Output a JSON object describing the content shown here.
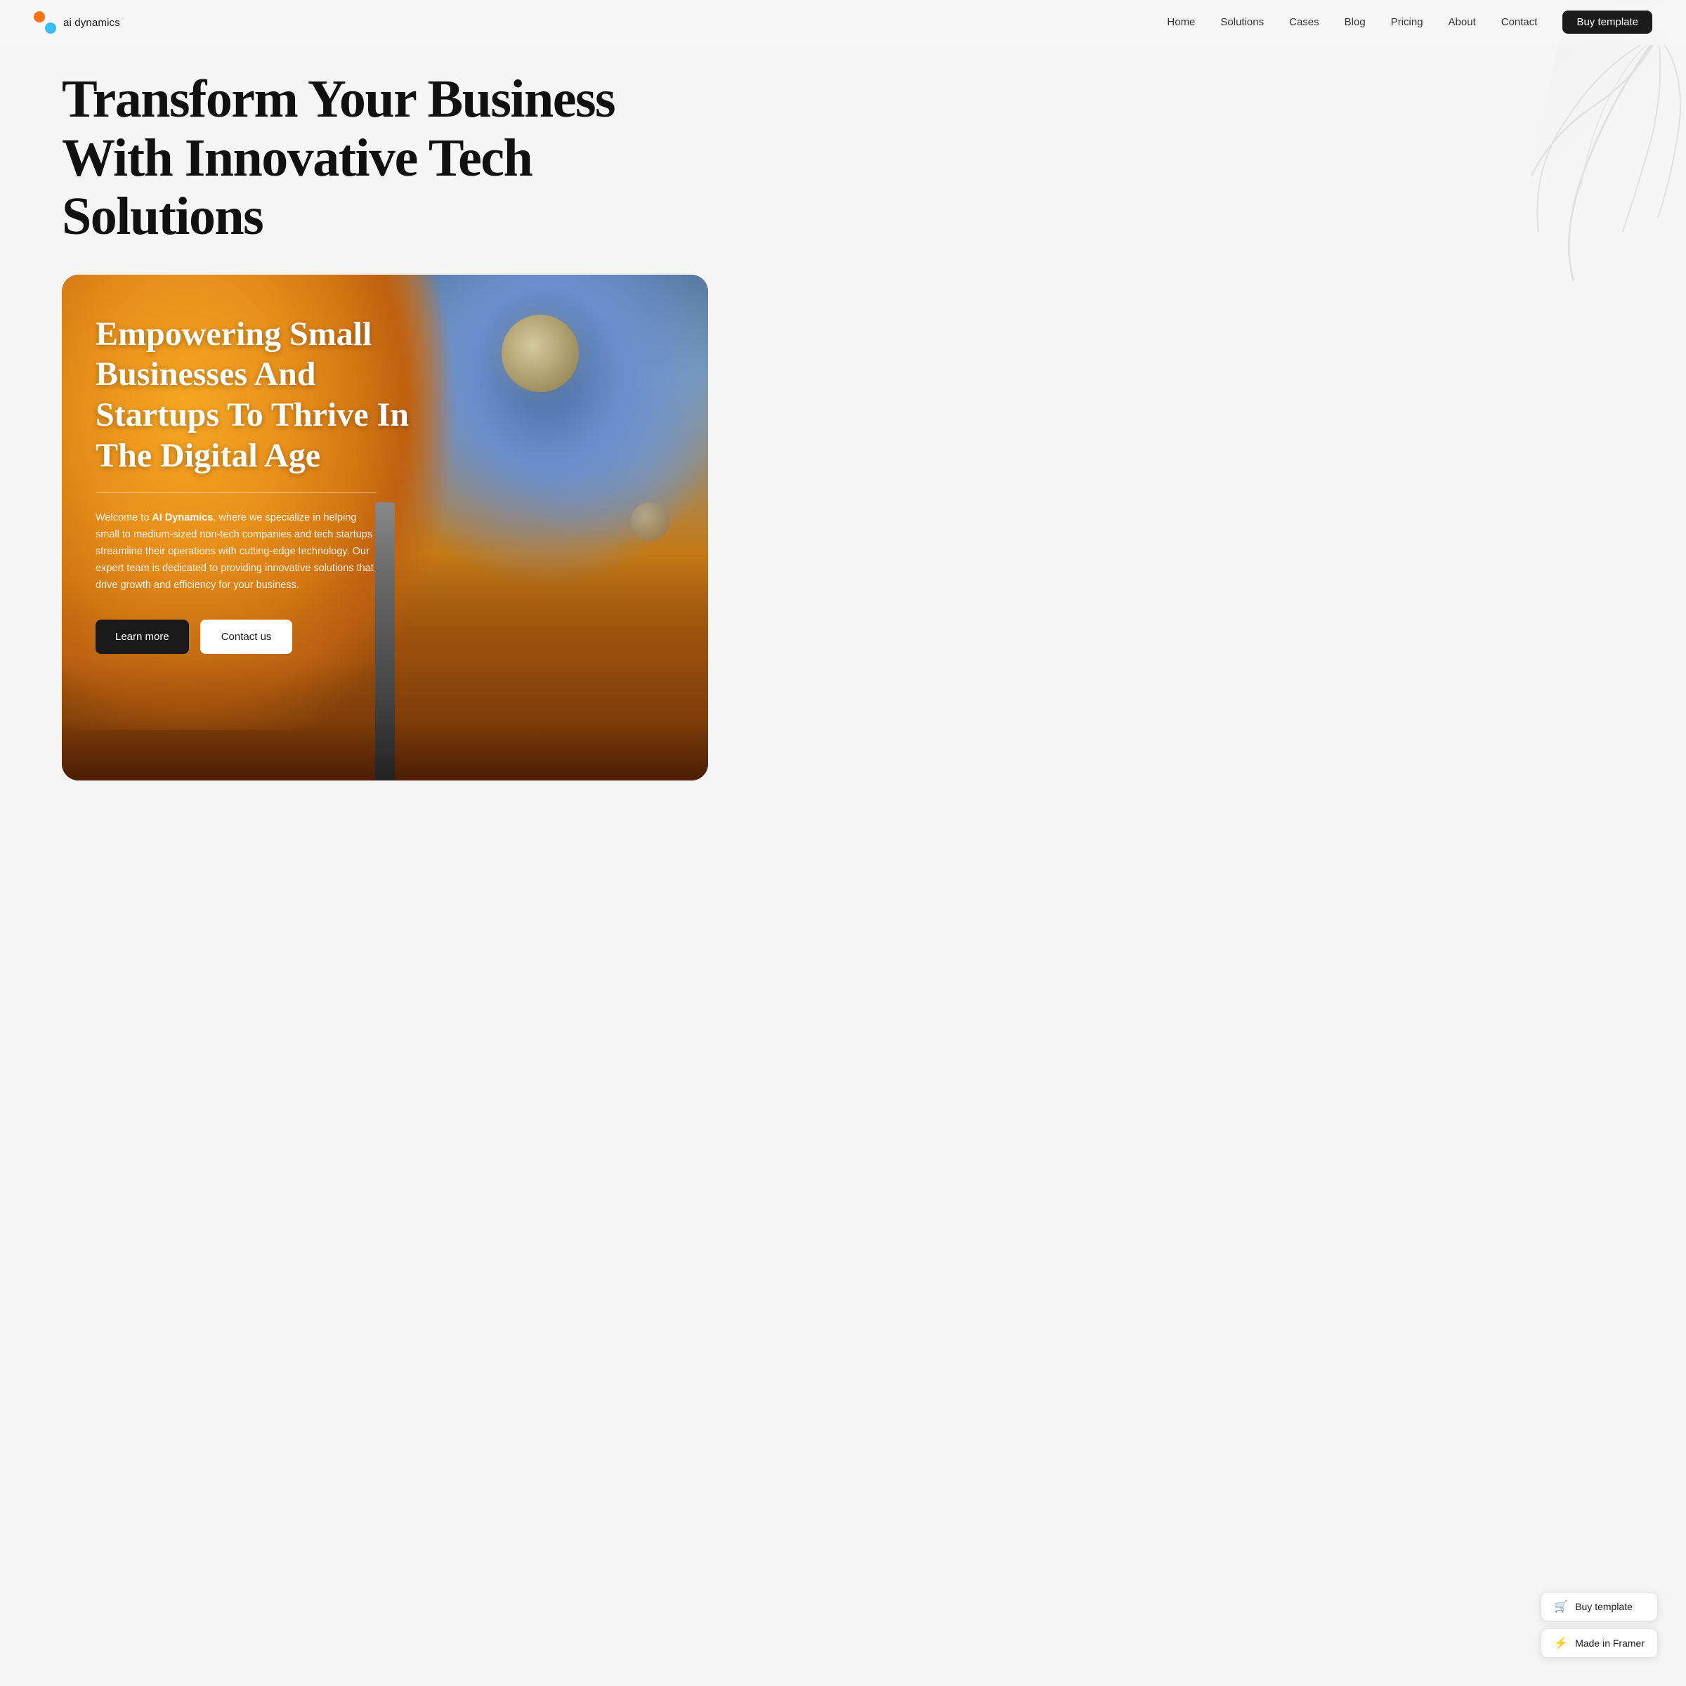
{
  "logo": {
    "text": "ai dynamics"
  },
  "nav": {
    "links": [
      {
        "label": "Home",
        "id": "home"
      },
      {
        "label": "Solutions",
        "id": "solutions"
      },
      {
        "label": "Cases",
        "id": "cases"
      },
      {
        "label": "Blog",
        "id": "blog"
      },
      {
        "label": "Pricing",
        "id": "pricing"
      },
      {
        "label": "About",
        "id": "about"
      },
      {
        "label": "Contact",
        "id": "contact"
      },
      {
        "label": "Buy template",
        "id": "buy",
        "special": true
      }
    ]
  },
  "hero": {
    "title": "Transform Your Business With Innovative Tech Solutions",
    "card": {
      "heading": "Empowering Small Businesses And Startups To Thrive In The Digital Age",
      "description_part1": "Welcome to ",
      "description_brand": "AI Dynamics",
      "description_part2": ", where we specialize in helping small to medium-sized non-tech companies and tech startups streamline their operations with cutting-edge technology. Our expert team is dedicated to providing innovative solutions that drive growth and efficiency for your business.",
      "btn_learn": "Learn more",
      "btn_contact": "Contact us"
    }
  },
  "widgets": {
    "buy_label": "Buy template",
    "made_label": "Made in Framer"
  }
}
